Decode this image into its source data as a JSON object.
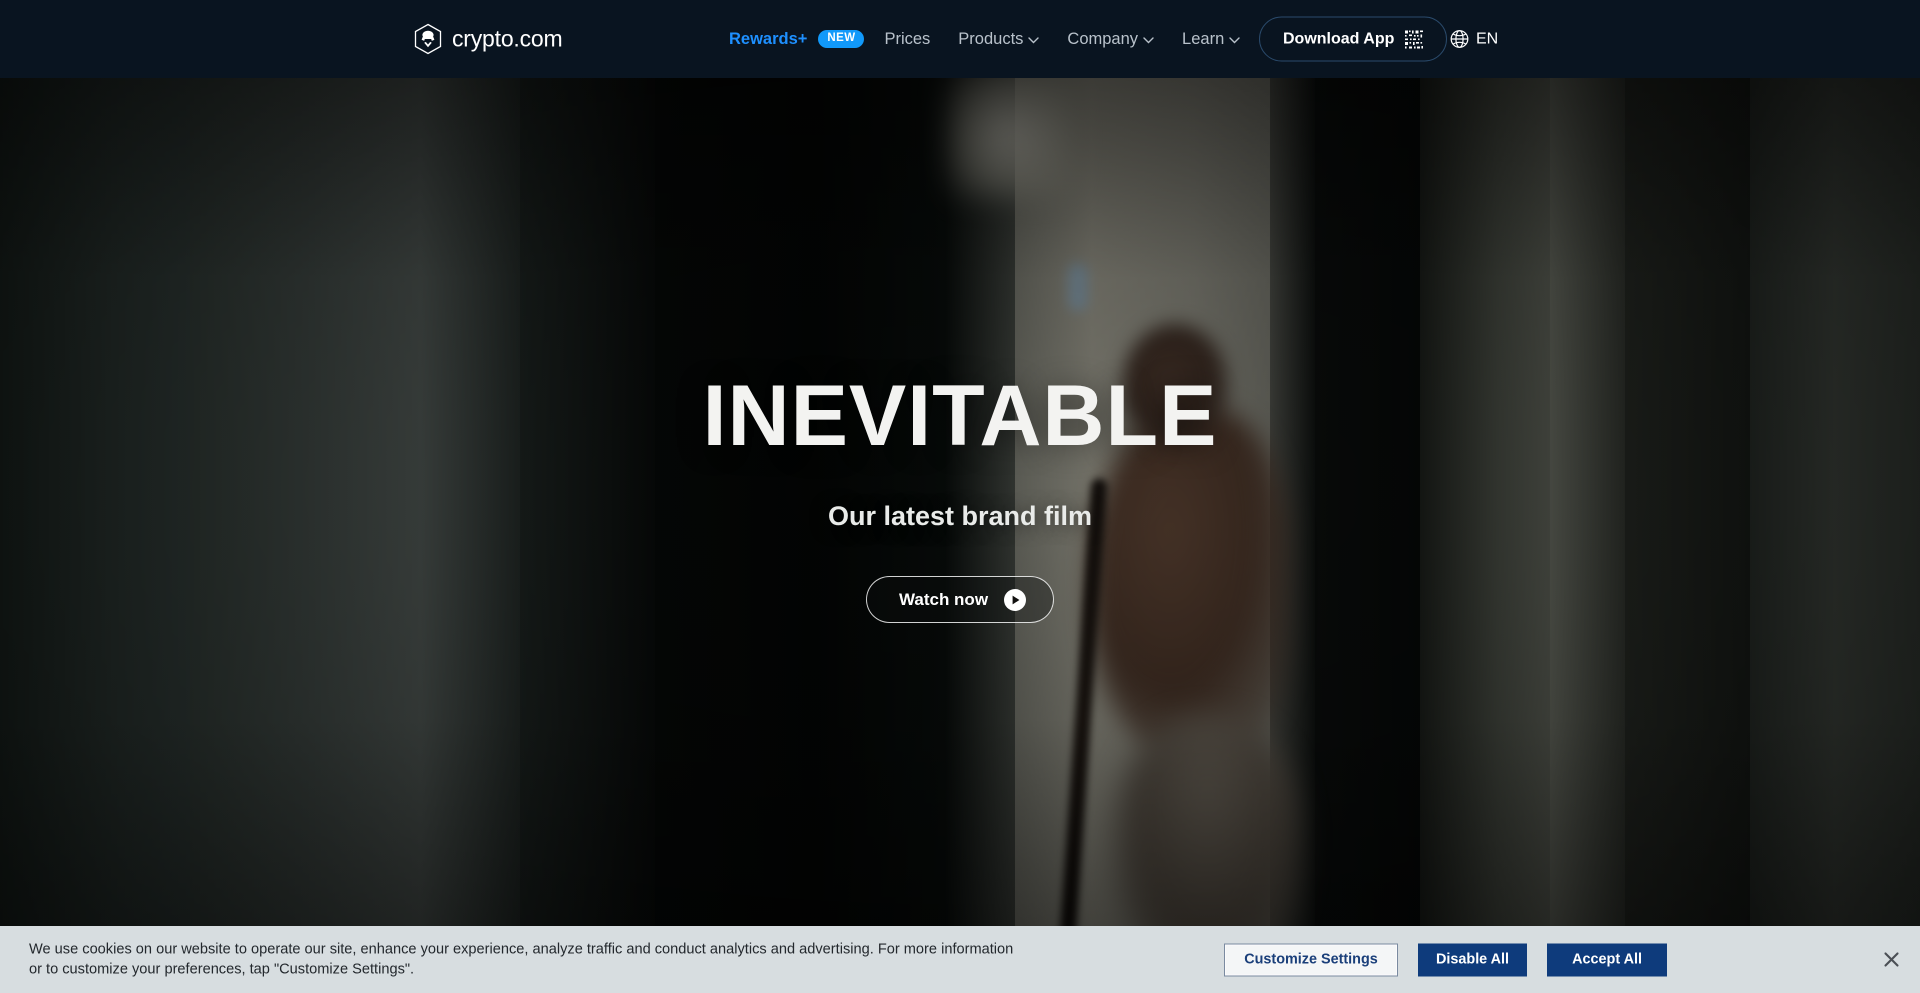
{
  "navbar": {
    "brand_name": "crypto.com",
    "brand_icon": "crypto-com-lion-hexagon-logo",
    "links": [
      {
        "label": "Rewards+",
        "badge": "NEW",
        "has_chevron": false,
        "accent": true
      },
      {
        "label": "Prices",
        "has_chevron": false,
        "accent": false
      },
      {
        "label": "Products",
        "has_chevron": true,
        "accent": false
      },
      {
        "label": "Company",
        "has_chevron": true,
        "accent": false
      },
      {
        "label": "Learn",
        "has_chevron": true,
        "accent": false
      }
    ],
    "download_label": "Download App",
    "download_icon": "qr-code-icon",
    "language_icon": "globe-icon",
    "language_label": "EN",
    "background_color": "#091420",
    "accent_color": "#1199fa",
    "link_color": "#b9c2cb"
  },
  "hero": {
    "title": "INEVITABLE",
    "subtitle": "Our latest brand film",
    "cta_label": "Watch now",
    "cta_icon": "play-circle-icon",
    "background_description": "blurred dark hallway scene with seated figure"
  },
  "cookie_banner": {
    "message": "We use cookies on our website to operate our site, enhance your experience, analyze traffic and conduct analytics and advertising. For more information or to customize your preferences, tap \"Customize Settings\".",
    "customize_label": "Customize Settings",
    "disable_label": "Disable All",
    "accept_label": "Accept All",
    "close_icon": "close-icon",
    "background_color": "#d7dde0",
    "primary_button_color": "#0e3b7c"
  }
}
